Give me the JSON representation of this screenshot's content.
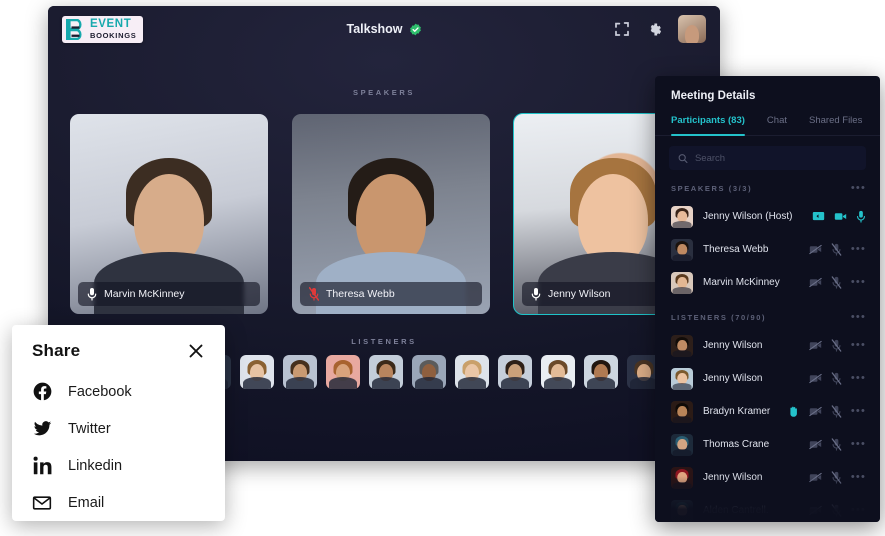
{
  "app": {
    "logo": {
      "mark": "eventbookings-b-icon",
      "top": "EVENT",
      "bottom": "BOOKINGS"
    },
    "header": {
      "title": "Talkshow",
      "verified_icon": "verified-badge-icon",
      "fullscreen_icon": "fullscreen-icon",
      "settings_icon": "gear-icon",
      "avatar": "user-avatar"
    },
    "speakers_label": "SPEAKERS",
    "listeners_label": "LISTENERS",
    "speakers": [
      {
        "name": "Marvin McKinney",
        "mic": "mic-on",
        "active": false
      },
      {
        "name": "Theresa Webb",
        "mic": "mic-muted",
        "active": false
      },
      {
        "name": "Jenny Wilson",
        "mic": "mic-on",
        "active": true
      }
    ],
    "listener_thumbs": 14
  },
  "share": {
    "title": "Share",
    "close_icon": "close-icon",
    "items": [
      {
        "label": "Facebook",
        "icon": "facebook-icon"
      },
      {
        "label": "Twitter",
        "icon": "twitter-icon"
      },
      {
        "label": "Linkedin",
        "icon": "linkedin-icon"
      },
      {
        "label": "Email",
        "icon": "email-icon"
      }
    ]
  },
  "details": {
    "title": "Meeting Details",
    "tabs": [
      {
        "label": "Participants (83)",
        "active": true
      },
      {
        "label": "Chat",
        "active": false
      },
      {
        "label": "Shared Files",
        "active": false
      }
    ],
    "search": {
      "placeholder": "Search",
      "value": "",
      "icon": "search-icon"
    },
    "groups": [
      {
        "title": "SPEAKERS (3/3)",
        "menu_icon": "more-options-icon",
        "rows": [
          {
            "name": "Jenny Wilson (Host)",
            "icons": [
              "screenshare-on",
              "video-on",
              "mic-on"
            ],
            "host": true,
            "dim": false
          },
          {
            "name": "Theresa Webb",
            "icons": [
              "video-off",
              "mic-off",
              "more"
            ],
            "host": false,
            "dim": false
          },
          {
            "name": "Marvin McKinney",
            "icons": [
              "video-off",
              "mic-off",
              "more"
            ],
            "host": false,
            "dim": false
          }
        ]
      },
      {
        "title": "LISTENERS (70/90)",
        "menu_icon": "more-options-icon",
        "rows": [
          {
            "name": "Jenny Wilson",
            "icons": [
              "video-off",
              "mic-off",
              "more"
            ],
            "hand": false,
            "dim": false
          },
          {
            "name": "Jenny Wilson",
            "icons": [
              "video-off",
              "mic-off",
              "more"
            ],
            "hand": false,
            "dim": false
          },
          {
            "name": "Bradyn Kramer",
            "icons": [
              "hand-raised",
              "video-off",
              "mic-off",
              "more"
            ],
            "hand": true,
            "dim": false
          },
          {
            "name": "Thomas Crane",
            "icons": [
              "video-off",
              "mic-off",
              "more"
            ],
            "hand": false,
            "dim": false
          },
          {
            "name": "Jenny Wilson",
            "icons": [
              "video-off",
              "mic-off",
              "more"
            ],
            "hand": false,
            "dim": false
          },
          {
            "name": "Alden Cantrell.",
            "icons": [
              "video-off",
              "mic-off",
              "more"
            ],
            "hand": false,
            "dim": true
          }
        ]
      }
    ]
  },
  "colors": {
    "accent": "#24c2cb",
    "panel_bg": "#0d0f1e",
    "app_bg": "#14162a",
    "mic_muted": "#e03a3a",
    "verified": "#2fbf6d"
  }
}
